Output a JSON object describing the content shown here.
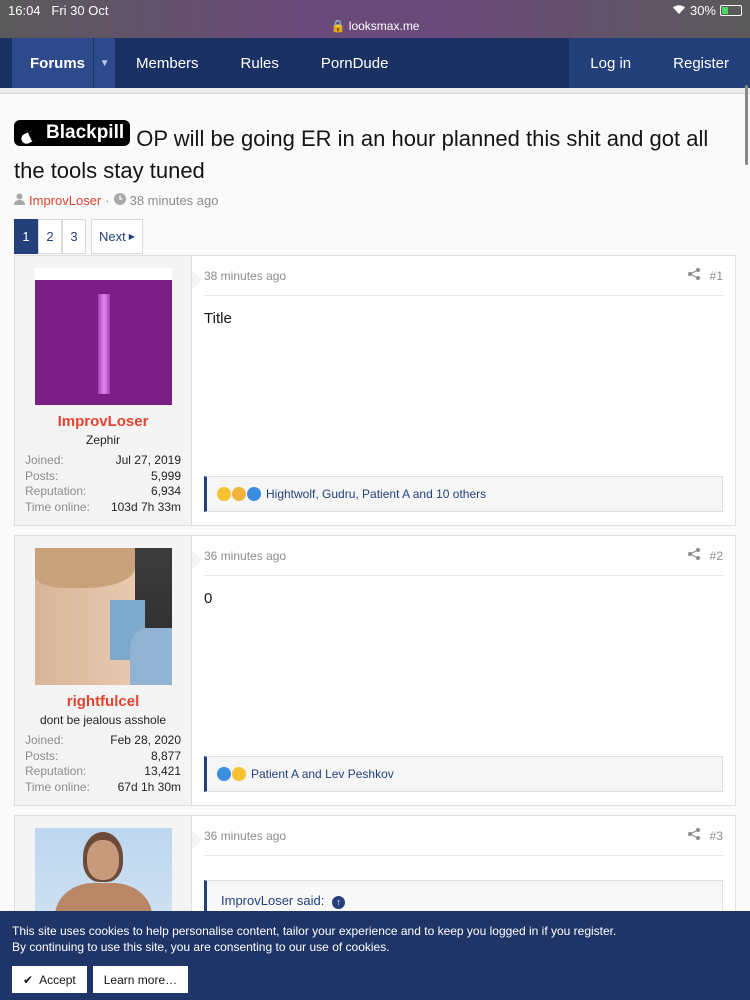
{
  "status": {
    "time": "16:04",
    "date": "Fri 30 Oct",
    "url": "looksmax.me",
    "battery": "30%"
  },
  "nav": {
    "forums": "Forums",
    "members": "Members",
    "rules": "Rules",
    "porndude": "PornDude",
    "login": "Log in",
    "register": "Register"
  },
  "thread": {
    "prefix": "Blackpill",
    "title": "OP will be going ER in an hour planned this shit and got all the tools stay tuned",
    "author": "ImprovLoser",
    "sep": "·",
    "age": "38 minutes ago"
  },
  "pager": {
    "pages": [
      "1",
      "2",
      "3"
    ],
    "next": "Next"
  },
  "posts": [
    {
      "time": "38 minutes ago",
      "num": "#1",
      "username": "ImprovLoser",
      "usertitle": "Zephir",
      "joined_label": "Joined:",
      "joined": "Jul 27, 2019",
      "posts_label": "Posts:",
      "posts": "5,999",
      "rep_label": "Reputation:",
      "rep": "6,934",
      "online_label": "Time online:",
      "online": "103d 7h 33m",
      "content": "Title",
      "reactions": "Hightwolf, Gudru, Patient A and 10 others"
    },
    {
      "time": "36 minutes ago",
      "num": "#2",
      "username": "rightfulcel",
      "usertitle": "dont be jealous asshole",
      "joined_label": "Joined:",
      "joined": "Feb 28, 2020",
      "posts_label": "Posts:",
      "posts": "8,877",
      "rep_label": "Reputation:",
      "rep": "13,421",
      "online_label": "Time online:",
      "online": "67d 1h 30m",
      "content": "0",
      "reactions": "Patient A and Lev Peshkov"
    },
    {
      "time": "36 minutes ago",
      "num": "#3",
      "quote": "ImprovLoser said:"
    }
  ],
  "cookie": {
    "line1": "This site uses cookies to help personalise content, tailor your experience and to keep you logged in if you register.",
    "line2": "By continuing to use this site, you are consenting to our use of cookies.",
    "accept": "Accept",
    "learn": "Learn more…"
  }
}
